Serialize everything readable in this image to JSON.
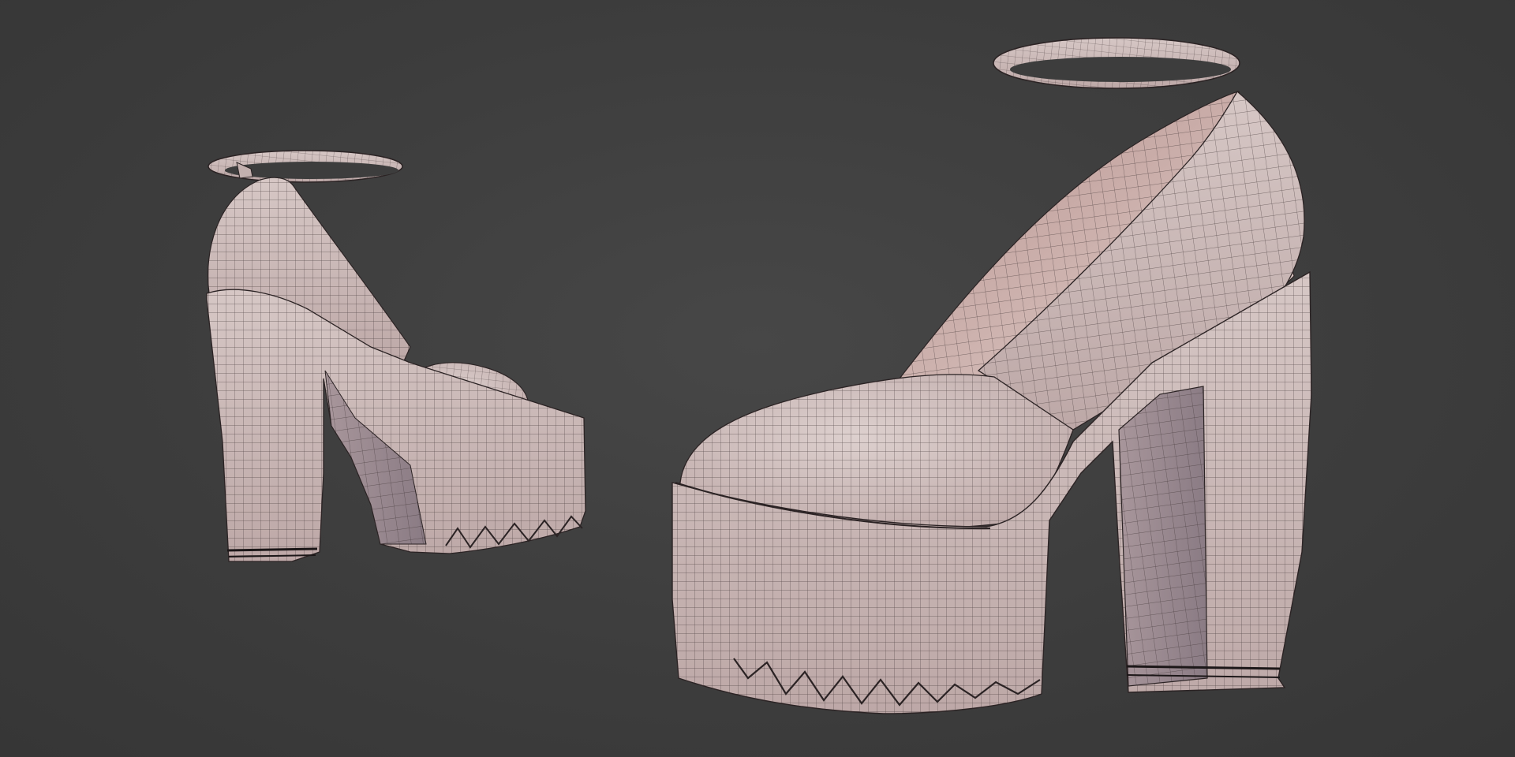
{
  "scene": {
    "background_color": "#3c3c3c",
    "material_color": "#c9b5b3",
    "material_shadow_color": "#8e7f86",
    "wire_color": "#3a2f30",
    "shading": "solid with wireframe overlay"
  },
  "objects": [
    {
      "id": "shoe-left",
      "description_icon": "platform-heel-shoe-icon",
      "view": "three-quarter rear"
    },
    {
      "id": "shoe-right",
      "description_icon": "platform-heel-shoe-icon",
      "view": "three-quarter front"
    }
  ]
}
